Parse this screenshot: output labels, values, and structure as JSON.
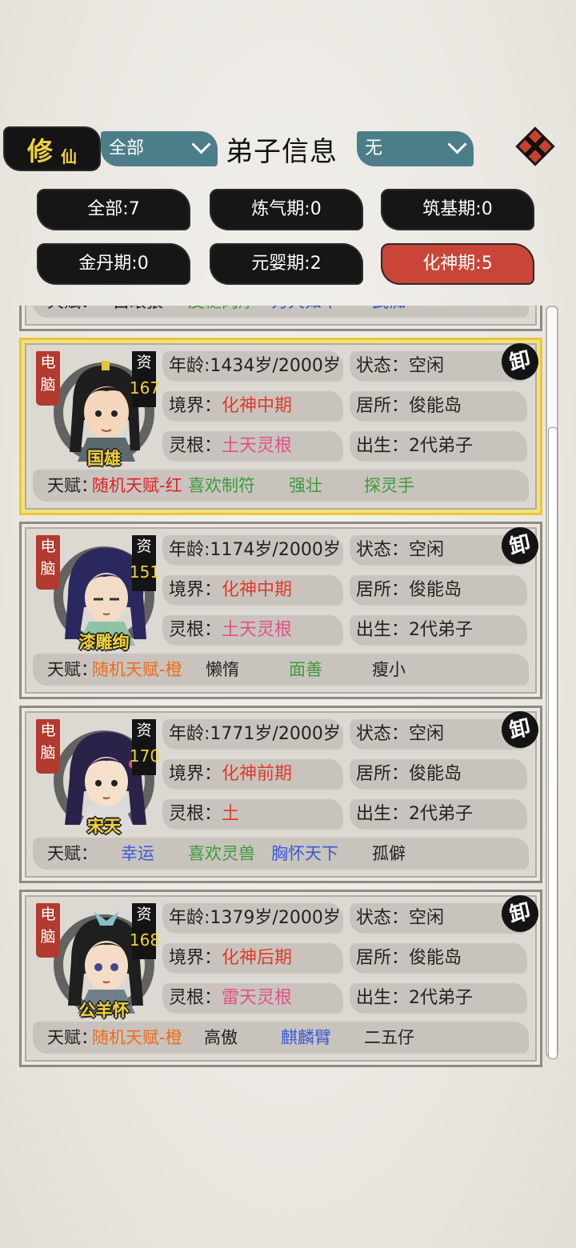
{
  "header": {
    "logo_big": "修",
    "logo_small": "仙",
    "filter_left": "全部",
    "title": "弟子信息",
    "filter_right": "无"
  },
  "realm_filters": [
    {
      "label": "全部:7",
      "active": false
    },
    {
      "label": "炼气期:0",
      "active": false
    },
    {
      "label": "筑基期:0",
      "active": false
    },
    {
      "label": "金丹期:0",
      "active": false
    },
    {
      "label": "元婴期:2",
      "active": false
    },
    {
      "label": "化神期:5",
      "active": true
    }
  ],
  "partial_card": {
    "talent_label": "天赋：",
    "talents": [
      "白眼狼",
      "皮糙肉厚",
      "力大如牛",
      "武痴"
    ]
  },
  "labels": {
    "ai": "电脑",
    "aptitude": "资",
    "age": "年龄:",
    "state": "状态：",
    "realm": "境界：",
    "residence": "居所：",
    "root": "灵根：",
    "birth": "出生：",
    "talent": "天赋：",
    "dismiss": "卸"
  },
  "disciples": [
    {
      "name": "国雄",
      "aptitude": "167",
      "age": "1434岁/2000岁",
      "state": "空闲",
      "realm": "化神中期",
      "residence": "俊能岛",
      "root": "土天灵根",
      "root_color": "pink",
      "birth": "2代弟子",
      "selected": true,
      "talents": [
        {
          "text": "随机天赋-红",
          "color": "redt"
        },
        {
          "text": "喜欢制符",
          "color": "green"
        },
        {
          "text": "强壮",
          "color": "green"
        },
        {
          "text": "探灵手",
          "color": "green"
        }
      ]
    },
    {
      "name": "漆雕绚",
      "aptitude": "151",
      "age": "1174岁/2000岁",
      "state": "空闲",
      "realm": "化神中期",
      "residence": "俊能岛",
      "root": "土天灵根",
      "root_color": "pink",
      "birth": "2代弟子",
      "selected": false,
      "talents": [
        {
          "text": "随机天赋-橙",
          "color": "orange"
        },
        {
          "text": "懒惰",
          "color": "black"
        },
        {
          "text": "面善",
          "color": "green"
        },
        {
          "text": "瘦小",
          "color": "black"
        }
      ]
    },
    {
      "name": "宋天",
      "aptitude": "170",
      "age": "1771岁/2000岁",
      "state": "空闲",
      "realm": "化神前期",
      "residence": "俊能岛",
      "root": "土",
      "root_color": "red",
      "birth": "2代弟子",
      "selected": false,
      "talents": [
        {
          "text": "幸运",
          "color": "blue"
        },
        {
          "text": "喜欢灵兽",
          "color": "green"
        },
        {
          "text": "胸怀天下",
          "color": "blue"
        },
        {
          "text": "孤僻",
          "color": "black"
        }
      ]
    },
    {
      "name": "公羊怀",
      "aptitude": "168",
      "age": "1379岁/2000岁",
      "state": "空闲",
      "realm": "化神后期",
      "residence": "俊能岛",
      "root": "雷天灵根",
      "root_color": "pink",
      "birth": "2代弟子",
      "selected": false,
      "talents": [
        {
          "text": "随机天赋-橙",
          "color": "orange"
        },
        {
          "text": "高傲",
          "color": "black"
        },
        {
          "text": "麒麟臂",
          "color": "blue"
        },
        {
          "text": "二五仔",
          "color": "black"
        }
      ]
    }
  ]
}
